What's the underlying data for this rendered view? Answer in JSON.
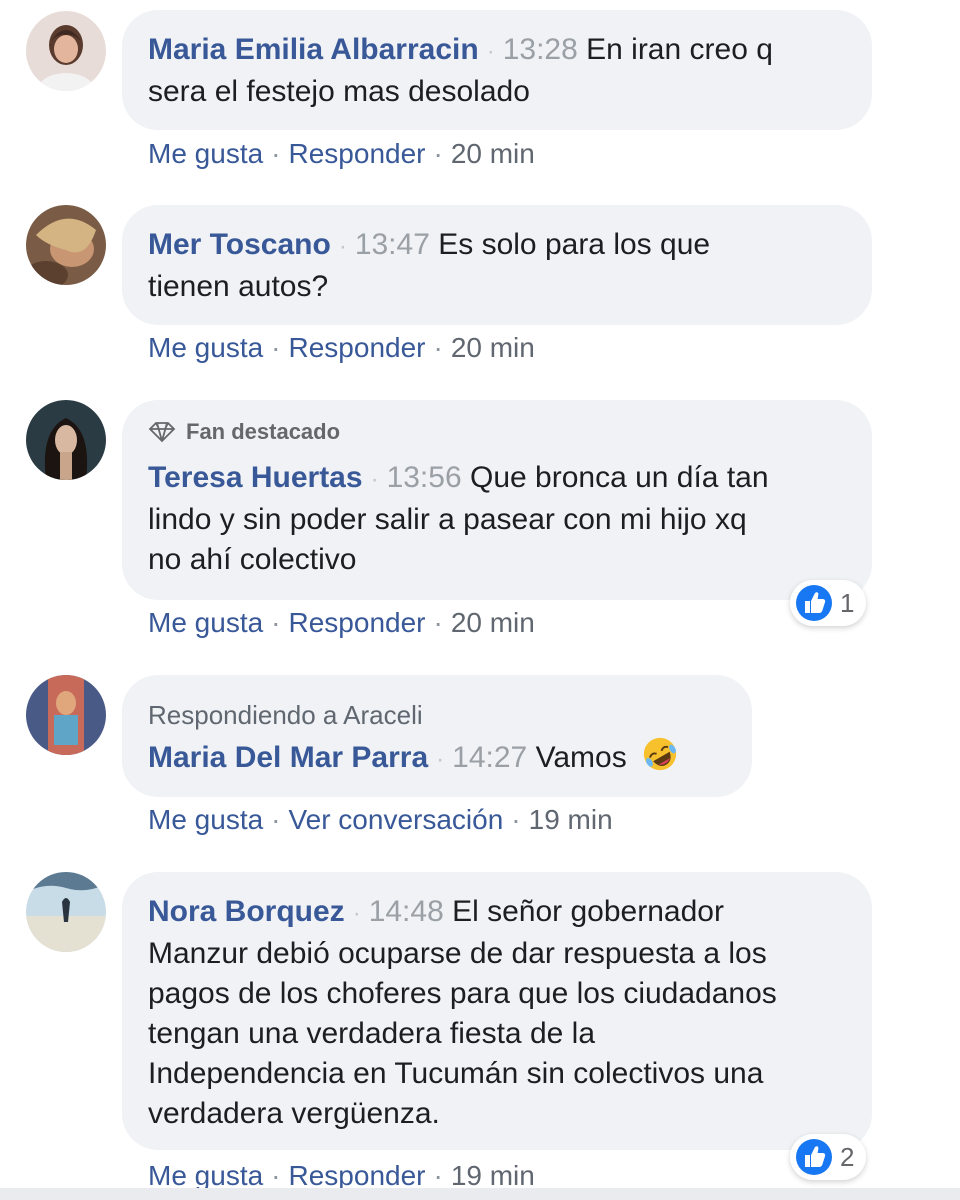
{
  "comments": [
    {
      "author": "Maria Emilia Albarracin",
      "time": "13:28",
      "lines": [
        "En iran creo q",
        "sera el festejo mas desolado"
      ],
      "actions": {
        "like": "Me gusta",
        "reply": "Responder",
        "age": "20 min"
      }
    },
    {
      "author": "Mer Toscano",
      "time": "13:47",
      "lines": [
        "Es solo para los que",
        "tienen autos?"
      ],
      "actions": {
        "like": "Me gusta",
        "reply": "Responder",
        "age": "20 min"
      }
    },
    {
      "badge": "Fan destacado",
      "author": "Teresa Huertas",
      "time": "13:56",
      "lines": [
        "Que bronca un día tan",
        "lindo y sin poder salir a pasear con mi hijo xq",
        "no ahí colectivo"
      ],
      "reactions": {
        "icon": "like-icon",
        "count": "1"
      },
      "actions": {
        "like": "Me gusta",
        "reply": "Responder",
        "age": "20 min"
      }
    },
    {
      "reply_to": "Respondiendo a Araceli",
      "author": "Maria Del Mar Parra",
      "time": "14:27",
      "lines": [
        "Vamos"
      ],
      "emoji": "rolling-laughing-emoji",
      "actions": {
        "like": "Me gusta",
        "reply": "Ver conversación",
        "age": "19 min"
      }
    },
    {
      "author": "Nora Borquez",
      "time": "14:48",
      "lines": [
        "El señor gobernador",
        "Manzur debió ocuparse de dar respuesta a los",
        "pagos de los choferes para que los ciudadanos",
        "tengan una verdadera fiesta de la",
        "Independencia en Tucumán sin colectivos una",
        "verdadera vergüenza."
      ],
      "reactions": {
        "icon": "like-icon",
        "count": "2"
      },
      "actions": {
        "like": "Me gusta",
        "reply": "Responder",
        "age": "19 min"
      }
    }
  ],
  "colors": {
    "author": "#385898",
    "bubble": "#f0f2f5",
    "timestamp": "#9aa0a6",
    "like_blue": "#1877f2"
  }
}
